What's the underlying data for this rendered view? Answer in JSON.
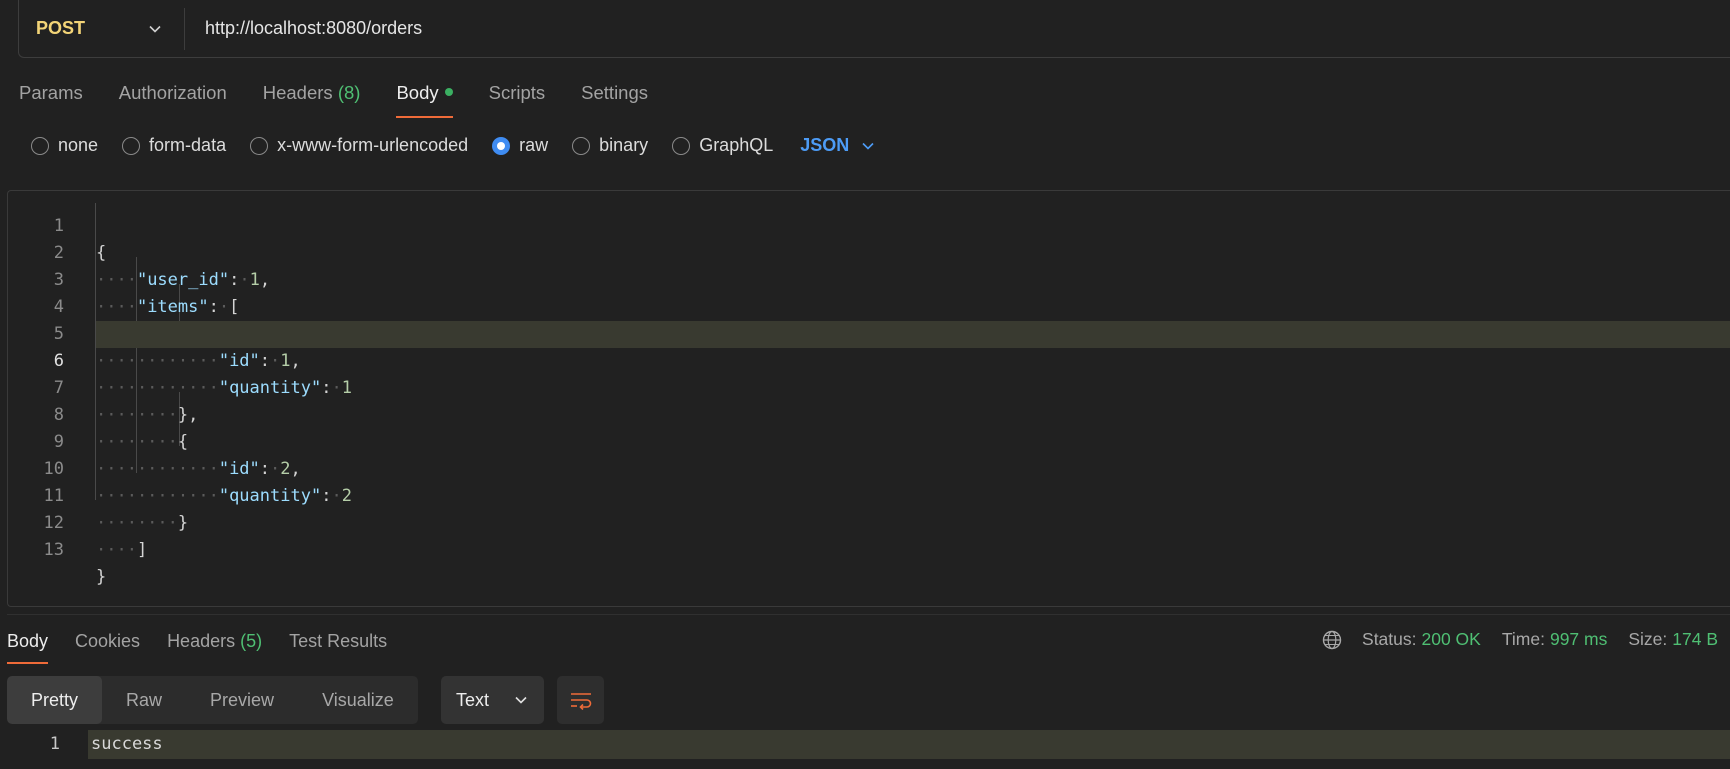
{
  "request": {
    "method": "POST",
    "url": "http://localhost:8080/orders"
  },
  "request_tabs": [
    {
      "label": "Params"
    },
    {
      "label": "Authorization"
    },
    {
      "label": "Headers",
      "count": "(8)"
    },
    {
      "label": "Body"
    },
    {
      "label": "Scripts"
    },
    {
      "label": "Settings"
    }
  ],
  "body_types": [
    "none",
    "form-data",
    "x-www-form-urlencoded",
    "raw",
    "binary",
    "GraphQL"
  ],
  "body_language": "JSON",
  "editor": {
    "line_numbers": [
      "1",
      "2",
      "3",
      "4",
      "5",
      "6",
      "7",
      "8",
      "9",
      "10",
      "11",
      "12",
      "13"
    ],
    "lines": {
      "l1": "{",
      "l2_key": "\"user_id\"",
      "l2_val": "1",
      "l3_key": "\"items\"",
      "l3_open": "[",
      "l4": "{",
      "l5_key": "\"id\"",
      "l5_val": "1",
      "l6_key": "\"quantity\"",
      "l6_val": "1",
      "l7": "},",
      "l8": "{",
      "l9_key": "\"id\"",
      "l9_val": "2",
      "l10_key": "\"quantity\"",
      "l10_val": "2",
      "l11": "}",
      "l12": "]",
      "l13": "}"
    }
  },
  "response_tabs": [
    {
      "label": "Body"
    },
    {
      "label": "Cookies"
    },
    {
      "label": "Headers",
      "count": "(5)"
    },
    {
      "label": "Test Results"
    }
  ],
  "status": {
    "status_label": "Status:",
    "status_value": "200 OK",
    "time_label": "Time:",
    "time_value": "997 ms",
    "size_label": "Size:",
    "size_value": "174 B"
  },
  "view_modes": [
    "Pretty",
    "Raw",
    "Preview",
    "Visualize"
  ],
  "response_format": "Text",
  "response_body": {
    "line_number": "1",
    "text": "success"
  },
  "colors": {
    "method": "#f3d477",
    "accent": "#ef6b39",
    "success": "#4fbf73",
    "link": "#4d9cf6"
  },
  "icons": {
    "method_dropdown": "chevron-down-icon",
    "language_dropdown": "chevron-down-icon",
    "network": "globe-icon",
    "wrap": "wrap-lines-icon"
  }
}
